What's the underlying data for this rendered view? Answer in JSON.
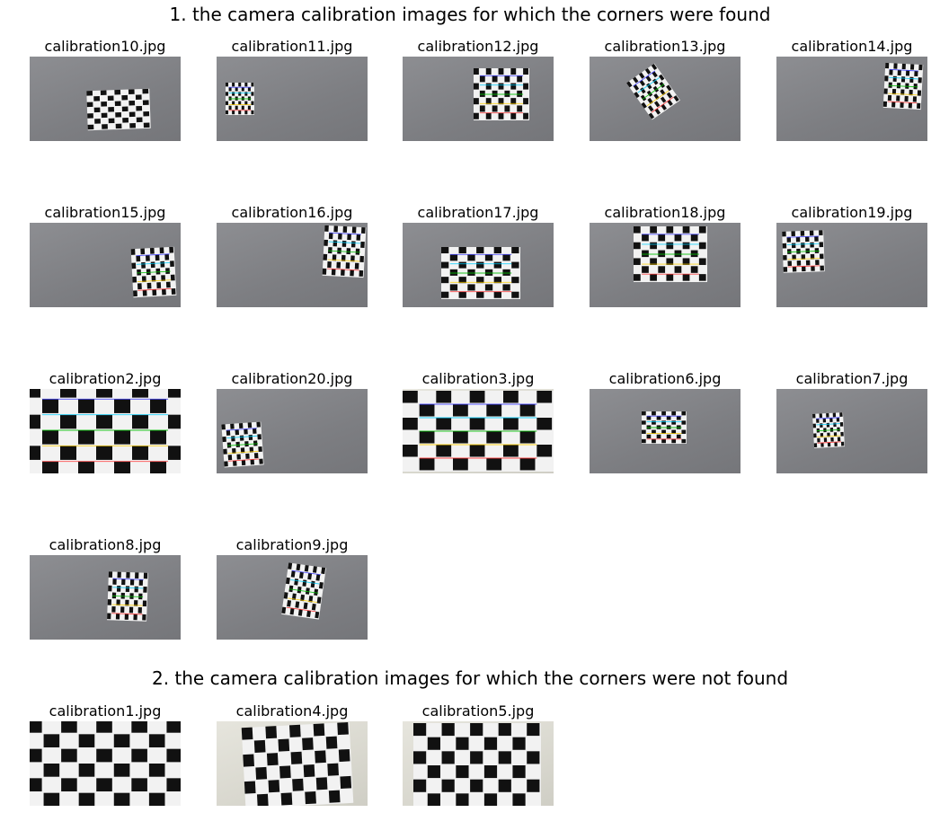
{
  "sections": [
    {
      "title": "1. the camera calibration images for which the corners were  found",
      "images": [
        {
          "label": "calibration10.jpg",
          "detected": true
        },
        {
          "label": "calibration11.jpg",
          "detected": true
        },
        {
          "label": "calibration12.jpg",
          "detected": true
        },
        {
          "label": "calibration13.jpg",
          "detected": true
        },
        {
          "label": "calibration14.jpg",
          "detected": true
        },
        {
          "label": "calibration15.jpg",
          "detected": true
        },
        {
          "label": "calibration16.jpg",
          "detected": true
        },
        {
          "label": "calibration17.jpg",
          "detected": true
        },
        {
          "label": "calibration18.jpg",
          "detected": true
        },
        {
          "label": "calibration19.jpg",
          "detected": true
        },
        {
          "label": "calibration2.jpg",
          "detected": true
        },
        {
          "label": "calibration20.jpg",
          "detected": true
        },
        {
          "label": "calibration3.jpg",
          "detected": true
        },
        {
          "label": "calibration6.jpg",
          "detected": true
        },
        {
          "label": "calibration7.jpg",
          "detected": true
        },
        {
          "label": "calibration8.jpg",
          "detected": true
        },
        {
          "label": "calibration9.jpg",
          "detected": true
        }
      ]
    },
    {
      "title": "2. the camera calibration images for which the corners were not found",
      "images": [
        {
          "label": "calibration1.jpg",
          "detected": false
        },
        {
          "label": "calibration4.jpg",
          "detected": false
        },
        {
          "label": "calibration5.jpg",
          "detected": false
        }
      ]
    }
  ],
  "colors": {
    "wall_gray": "#808185",
    "wall_light": "#dcdbd2",
    "board_dark": "#111111",
    "board_light": "#f2f2f2",
    "corner_lines": [
      "#3b3bff",
      "#00d0ff",
      "#00c000",
      "#ffd000",
      "#ff3030"
    ]
  }
}
